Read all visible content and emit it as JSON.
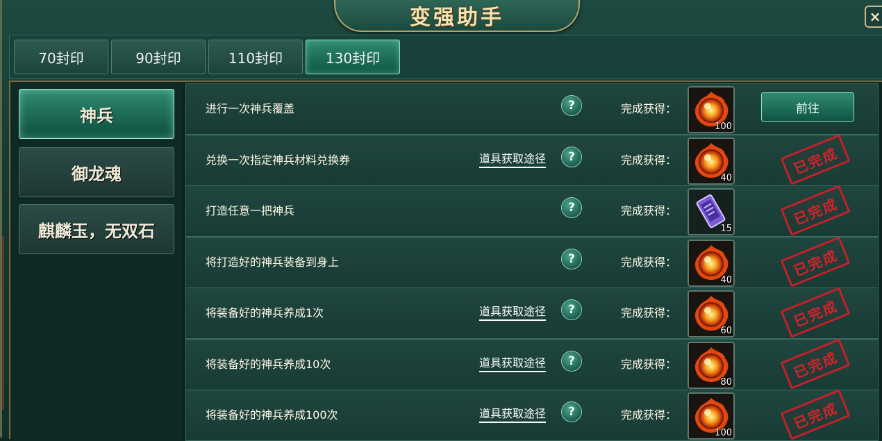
{
  "window": {
    "title": "变强助手",
    "close_icon": "×"
  },
  "tabs": [
    {
      "label": "70封印",
      "active": false
    },
    {
      "label": "90封印",
      "active": false
    },
    {
      "label": "110封印",
      "active": false
    },
    {
      "label": "130封印",
      "active": true
    }
  ],
  "sidebar": [
    {
      "label": "神兵",
      "active": true
    },
    {
      "label": "御龙魂",
      "active": false
    },
    {
      "label": "麒麟玉，无双石",
      "active": false
    }
  ],
  "common": {
    "reward_label": "完成获得：",
    "help_glyph": "?",
    "source_link": "道具获取途径",
    "go_button": "前往",
    "done_stamp": "已完成"
  },
  "tasks": [
    {
      "desc": "进行一次神兵覆盖",
      "has_link": false,
      "reward_icon": "fire-orb-icon",
      "qty": "100",
      "status": "go"
    },
    {
      "desc": "兑换一次指定神兵材料兑换券",
      "has_link": true,
      "reward_icon": "fire-orb-icon",
      "qty": "40",
      "status": "done"
    },
    {
      "desc": "打造任意一把神兵",
      "has_link": false,
      "reward_icon": "purple-scroll-icon",
      "qty": "15",
      "status": "done"
    },
    {
      "desc": "将打造好的神兵装备到身上",
      "has_link": false,
      "reward_icon": "fire-orb-icon",
      "qty": "40",
      "status": "done"
    },
    {
      "desc": "将装备好的神兵养成1次",
      "has_link": true,
      "reward_icon": "fire-orb-icon",
      "qty": "60",
      "status": "done"
    },
    {
      "desc": "将装备好的神兵养成10次",
      "has_link": true,
      "reward_icon": "fire-orb-icon",
      "qty": "80",
      "status": "done"
    },
    {
      "desc": "将装备好的神兵养成100次",
      "has_link": true,
      "reward_icon": "fire-orb-icon",
      "qty": "100",
      "status": "done"
    }
  ],
  "colors": {
    "accent": "#8fe2c0",
    "gold": "#f4e3b4",
    "stamp": "#c4202a"
  }
}
